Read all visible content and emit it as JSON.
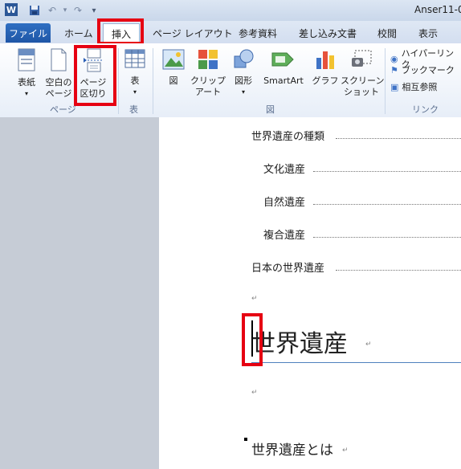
{
  "window": {
    "title": "Anser11-0"
  },
  "tabs": {
    "file": "ファイル",
    "home": "ホーム",
    "insert": "挿入",
    "page_layout": "ページ レイアウト",
    "references": "参考資料",
    "mailings": "差し込み文書",
    "review": "校閲",
    "view": "表示"
  },
  "ribbon": {
    "cover": "表紙",
    "blank_page": "空白の\nページ",
    "page_break": "ページ\n区切り",
    "table": "表",
    "picture": "図",
    "clipart": "クリップ\nアート",
    "shapes": "図形",
    "smartart": "SmartArt",
    "chart": "グラフ",
    "screenshot": "スクリーン\nショット",
    "hyperlink": "ハイパーリンク",
    "bookmark": "ブックマーク",
    "crossref": "相互参照",
    "group_pages": "ページ",
    "group_tables": "表",
    "group_illustrations": "図",
    "group_links": "リンク"
  },
  "document": {
    "toc": [
      "世界遺産の種類",
      "文化遺産",
      "自然遺産",
      "複合遺産",
      "日本の世界遺産"
    ],
    "heading1": "世界遺産",
    "heading2": "世界遺産とは",
    "paragraph_mark": "↵"
  },
  "colors": {
    "highlight": "#e60012",
    "file_tab": "#2a64b8"
  }
}
